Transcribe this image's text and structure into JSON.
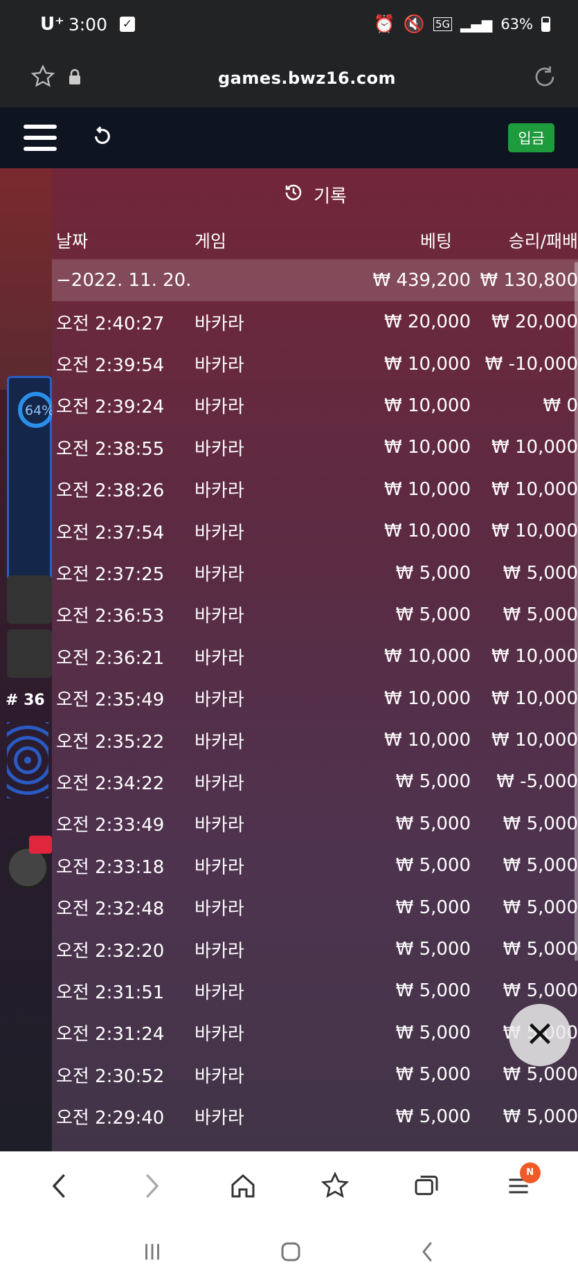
{
  "status_bar": {
    "carrier": "U⁺",
    "time": "3:00",
    "network": "5G",
    "battery": "63%"
  },
  "browser": {
    "url": "games.bwz16.com"
  },
  "app_header": {
    "deposit_label": "입금"
  },
  "history": {
    "title": "기록",
    "columns": {
      "date": "날짜",
      "game": "게임",
      "bet": "베팅",
      "result": "승리/패배"
    },
    "date_row": {
      "date": "−2022. 11. 20.",
      "bet_total": "₩ 439,200",
      "result_total": "₩ 130,800"
    },
    "rows": [
      {
        "time": "오전 2:40:27",
        "game": "바카라",
        "bet": "₩ 20,000",
        "result": "₩ 20,000"
      },
      {
        "time": "오전 2:39:54",
        "game": "바카라",
        "bet": "₩ 10,000",
        "result": "₩ -10,000"
      },
      {
        "time": "오전 2:39:24",
        "game": "바카라",
        "bet": "₩ 10,000",
        "result": "₩ 0"
      },
      {
        "time": "오전 2:38:55",
        "game": "바카라",
        "bet": "₩ 10,000",
        "result": "₩ 10,000"
      },
      {
        "time": "오전 2:38:26",
        "game": "바카라",
        "bet": "₩ 10,000",
        "result": "₩ 10,000"
      },
      {
        "time": "오전 2:37:54",
        "game": "바카라",
        "bet": "₩ 10,000",
        "result": "₩ 10,000"
      },
      {
        "time": "오전 2:37:25",
        "game": "바카라",
        "bet": "₩ 5,000",
        "result": "₩ 5,000"
      },
      {
        "time": "오전 2:36:53",
        "game": "바카라",
        "bet": "₩ 5,000",
        "result": "₩ 5,000"
      },
      {
        "time": "오전 2:36:21",
        "game": "바카라",
        "bet": "₩ 10,000",
        "result": "₩ 10,000"
      },
      {
        "time": "오전 2:35:49",
        "game": "바카라",
        "bet": "₩ 10,000",
        "result": "₩ 10,000"
      },
      {
        "time": "오전 2:35:22",
        "game": "바카라",
        "bet": "₩ 10,000",
        "result": "₩ 10,000"
      },
      {
        "time": "오전 2:34:22",
        "game": "바카라",
        "bet": "₩ 5,000",
        "result": "₩ -5,000"
      },
      {
        "time": "오전 2:33:49",
        "game": "바카라",
        "bet": "₩ 5,000",
        "result": "₩ 5,000"
      },
      {
        "time": "오전 2:33:18",
        "game": "바카라",
        "bet": "₩ 5,000",
        "result": "₩ 5,000"
      },
      {
        "time": "오전 2:32:48",
        "game": "바카라",
        "bet": "₩ 5,000",
        "result": "₩ 5,000"
      },
      {
        "time": "오전 2:32:20",
        "game": "바카라",
        "bet": "₩ 5,000",
        "result": "₩ 5,000"
      },
      {
        "time": "오전 2:31:51",
        "game": "바카라",
        "bet": "₩ 5,000",
        "result": "₩ 5,000"
      },
      {
        "time": "오전 2:31:24",
        "game": "바카라",
        "bet": "₩ 5,000",
        "result": "₩ 5,000"
      },
      {
        "time": "오전 2:30:52",
        "game": "바카라",
        "bet": "₩ 5,000",
        "result": "₩ 5,000"
      },
      {
        "time": "오전 2:29:40",
        "game": "바카라",
        "bet": "₩ 5,000",
        "result": "₩ 5,000"
      }
    ]
  },
  "background": {
    "round": "# 36",
    "win_rate": "64%"
  },
  "nav": {
    "badge": "N"
  },
  "colors": {
    "deposit": "#1e9b3c",
    "badge": "#f05a28"
  }
}
